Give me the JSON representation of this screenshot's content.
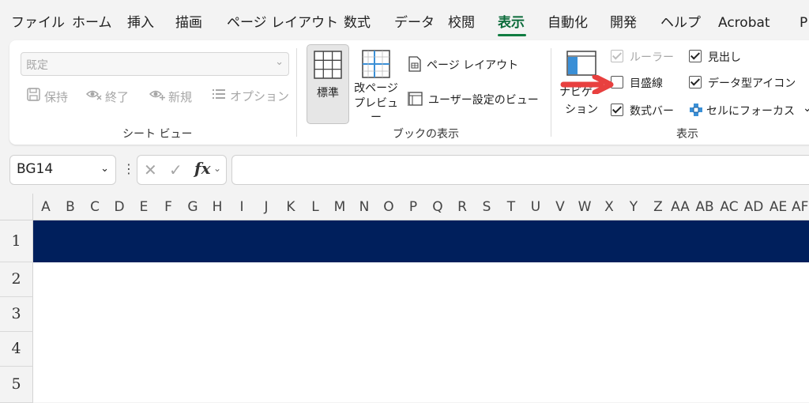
{
  "menu": {
    "items": [
      "ファイル",
      "ホーム",
      "挿入",
      "描画",
      "ページ レイアウト",
      "数式",
      "データ",
      "校閲",
      "表示",
      "自動化",
      "開発",
      "ヘルプ",
      "Acrobat",
      "P"
    ],
    "active": "表示"
  },
  "sheet_view": {
    "selected_view": "既定",
    "buttons": [
      "保持",
      "終了",
      "新規",
      "オプション"
    ],
    "label": "シート ビュー"
  },
  "workbook_views": {
    "normal": "標準",
    "page_break_line1": "改ページ",
    "page_break_line2": "プレビュー",
    "page_layout": "ページ レイアウト",
    "custom_views": "ユーザー設定のビュー",
    "label": "ブックの表示"
  },
  "show": {
    "navigation_line1": "ナビゲー",
    "navigation_line2": "ション",
    "ruler": "ルーラー",
    "gridlines": "目盛線",
    "formula_bar": "数式バー",
    "headings": "見出し",
    "data_type_icons": "データ型アイコン",
    "focus_cell": "セルにフォーカス",
    "label": "表示",
    "more": "⌄"
  },
  "state": {
    "ruler_checked": true,
    "gridlines_checked": false,
    "formula_bar_checked": true,
    "headings_checked": true,
    "data_type_icons_checked": true
  },
  "formula_bar": {
    "name_box": "BG14",
    "fx": "fx",
    "value": ""
  },
  "columns": [
    "A",
    "B",
    "C",
    "D",
    "E",
    "F",
    "G",
    "H",
    "I",
    "J",
    "K",
    "L",
    "M",
    "N",
    "O",
    "P",
    "Q",
    "R",
    "S",
    "T",
    "U",
    "V",
    "W",
    "X",
    "Y",
    "Z",
    "AA",
    "AB",
    "AC",
    "AD",
    "AE",
    "AF"
  ],
  "rows": [
    "1",
    "2",
    "3",
    "4",
    "5"
  ],
  "colors": {
    "accent": "#107c41",
    "row1_fill": "#001f5c",
    "arrow": "#e8403f"
  }
}
